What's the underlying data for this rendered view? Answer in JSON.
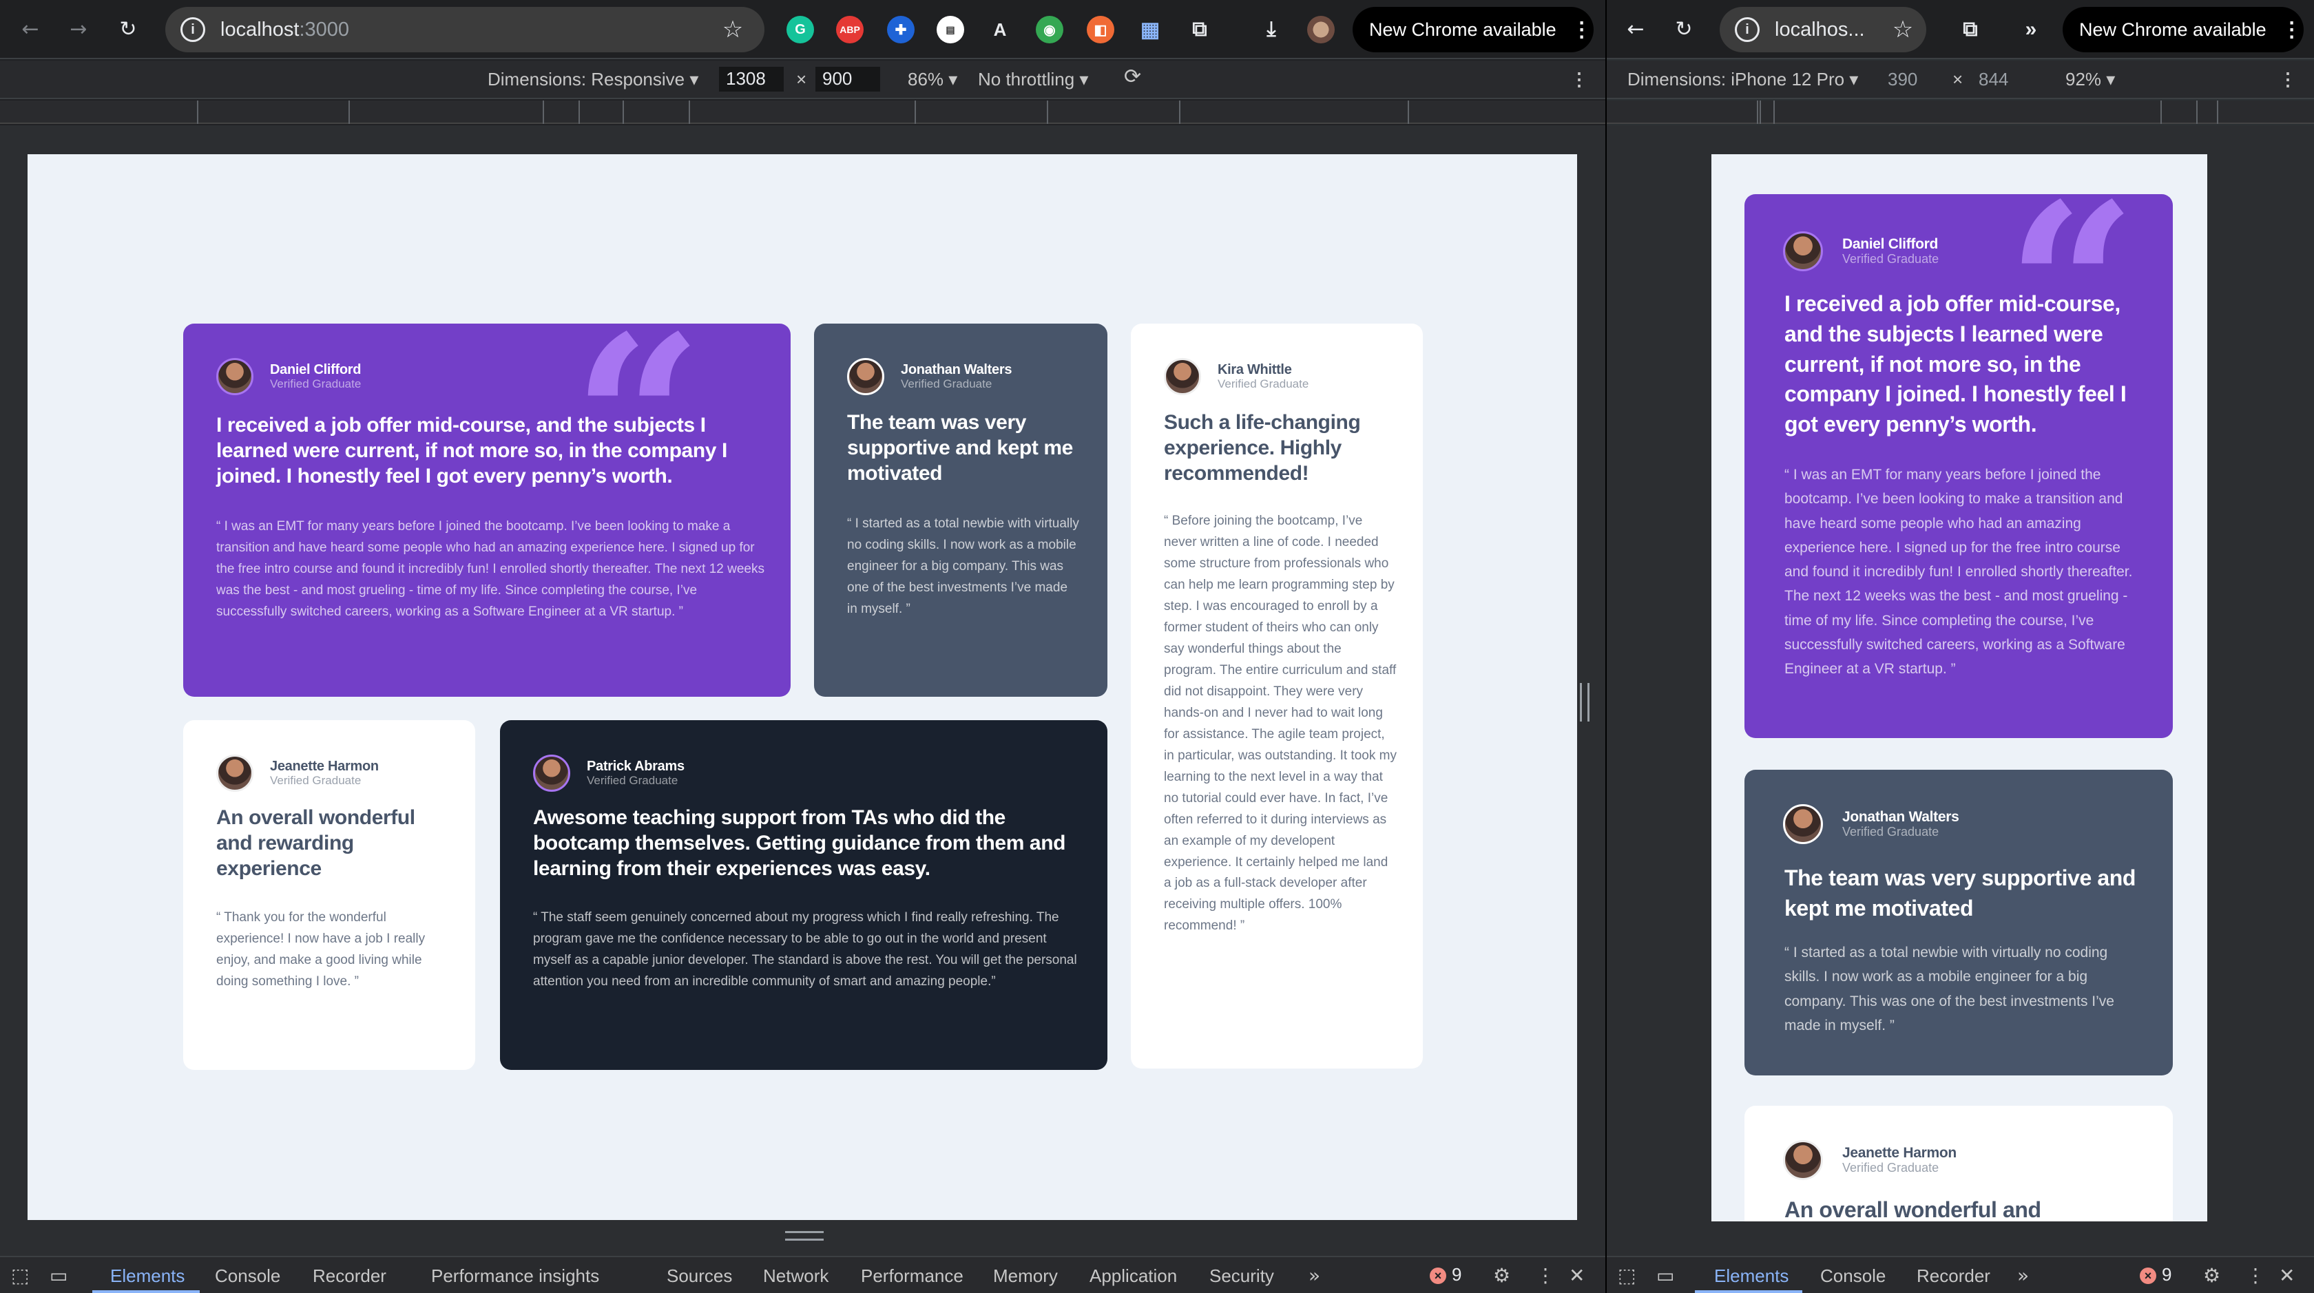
{
  "browser_left": {
    "url_host": "localhost",
    "url_port": ":3000",
    "update_label": "New Chrome available",
    "devtools": {
      "dimensions_label": "Dimensions: Responsive",
      "width_value": "1308",
      "times": "×",
      "height_value": "900",
      "zoom": "86%",
      "throttling": "No throttling"
    },
    "tabs": [
      "Elements",
      "Console",
      "Recorder",
      "Performance insights",
      "Sources",
      "Network",
      "Performance",
      "Memory",
      "Application",
      "Security"
    ],
    "error_count": "9"
  },
  "browser_right": {
    "url_display": "localhos...",
    "update_label": "New Chrome available",
    "devtools": {
      "dimensions_label": "Dimensions: iPhone 12 Pro",
      "width_value": "390",
      "times": "×",
      "height_value": "844",
      "zoom": "92%"
    },
    "tabs": [
      "Elements",
      "Console",
      "Recorder"
    ],
    "error_count": "9"
  },
  "testimonials": {
    "daniel": {
      "name": "Daniel Clifford",
      "role": "Verified Graduate",
      "headline": "I received a job offer mid-course, and the subjects I learned were current, if not more so, in the company I joined. I honestly feel I got every penny’s worth.",
      "quote": "“ I was an EMT for many years before I joined the bootcamp. I’ve been looking to make a transition and have heard some people who had an amazing experience here. I signed up for the free intro course and found it incredibly fun! I enrolled shortly thereafter. The next 12 weeks was the best - and most grueling - time of my life. Since completing the course, I’ve successfully switched careers, working as a Software Engineer at a VR startup. ”"
    },
    "jonathan": {
      "name": "Jonathan Walters",
      "role": "Verified Graduate",
      "headline": "The team was very supportive and kept me motivated",
      "quote": "“ I started as a total newbie with virtually no coding skills. I now work as a mobile engineer for a big company. This was one of the best investments I’ve made in myself. ”"
    },
    "kira": {
      "name": "Kira Whittle",
      "role": "Verified Graduate",
      "headline": "Such a life-changing experience. Highly recommended!",
      "quote": "“ Before joining the bootcamp, I’ve never written a line of code. I needed some structure from professionals who can help me learn programming step by step. I was encouraged to enroll by a former student of theirs who can only say wonderful things about the program. The entire curriculum and staff did not disappoint. They were very hands-on and I never had to wait long for assistance. The agile team project, in particular, was outstanding. It took my learning to the next level in a way that no tutorial could ever have. In fact, I’ve often referred to it during interviews as an example of my developent experience. It certainly helped me land a job as a full-stack developer after receiving multiple offers. 100% recommend! ”"
    },
    "jeanette": {
      "name": "Jeanette Harmon",
      "role": "Verified Graduate",
      "headline": "An overall wonderful and rewarding experience",
      "quote": "“ Thank you for the wonderful experience! I now have a job I really enjoy, and make a good living while doing something I love. ”"
    },
    "patrick": {
      "name": "Patrick Abrams",
      "role": "Verified Graduate",
      "headline": "Awesome teaching support from TAs who did the bootcamp themselves. Getting guidance from them and learning from their experiences was easy.",
      "quote": "“ The staff seem genuinely concerned about my progress which I find really refreshing. The program gave me the confidence necessary to be able to go out in the world and present myself as a capable junior developer. The standard is above the rest. You will get the personal attention you need from an incredible community of smart and amazing people.”"
    }
  },
  "mobile_partial_headline": "An overall wonderful and",
  "colors": {
    "purple": "#733fc8",
    "grey": "#48556a",
    "dark": "#19212e",
    "bg": "#edf2f8",
    "quote_mark": "#a775f1"
  }
}
